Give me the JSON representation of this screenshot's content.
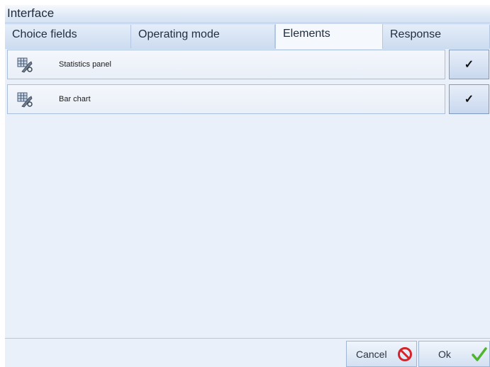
{
  "window": {
    "title": "Interface"
  },
  "tabs": [
    {
      "label": "Choice fields",
      "active": false
    },
    {
      "label": "Operating mode",
      "active": false
    },
    {
      "label": "Elements",
      "active": true
    },
    {
      "label": "Response",
      "active": false
    }
  ],
  "elements": [
    {
      "label": "Statistics panel",
      "icon": "tools-icon",
      "checked": true,
      "check_glyph": "✓"
    },
    {
      "label": "Bar chart",
      "icon": "tools-icon",
      "checked": true,
      "check_glyph": "✓"
    }
  ],
  "footer": {
    "cancel_label": "Cancel",
    "cancel_icon": "no-entry-icon",
    "cancel_color": "#d6232a",
    "ok_label": "Ok",
    "ok_icon": "checkmark-icon",
    "ok_color": "#4fb52e"
  }
}
